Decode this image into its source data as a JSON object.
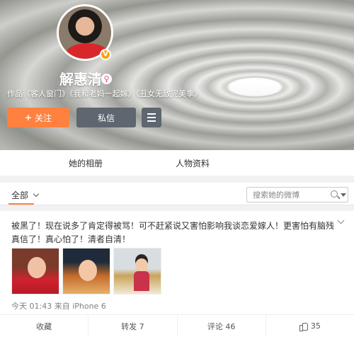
{
  "profile": {
    "name": "解惠清",
    "intro": "作品《客人窗门》《我和老妈一起嫁》《丑女无敌完美季》",
    "follow_label": "关注",
    "follow_icon": "+",
    "message_label": "私信"
  },
  "tabs": {
    "album": "她的相册",
    "profile": "人物资料"
  },
  "filter": {
    "all_label": "全部",
    "search_placeholder": "搜索她的微博"
  },
  "post": {
    "text": "被黑了！现在说多了肯定得被骂！可不赶紧说又害怕影响我谈恋爱嫁人！更害怕有脑残真信了！真心怕了！清者自清！",
    "meta": "今天 01:43 来自 iPhone 6",
    "actions": {
      "favorite": "收藏",
      "repost": "转发 7",
      "comment": "评论 46",
      "like": "35"
    }
  },
  "colors": {
    "accent": "#ff8140",
    "button_dark": "#5e6670",
    "verified": "#f7a31c"
  }
}
